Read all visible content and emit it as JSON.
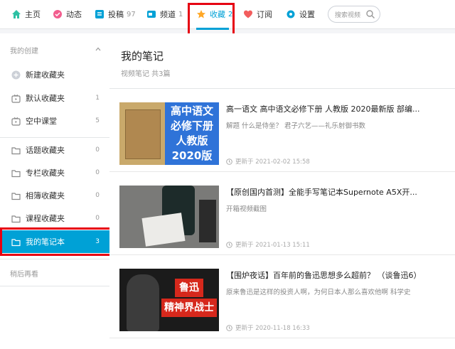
{
  "nav": {
    "home": "主页",
    "dynamic": "动态",
    "posts": "投稿",
    "posts_count": "97",
    "channel": "频道",
    "channel_count": "1",
    "favorites": "收藏",
    "favorites_count": "2",
    "subscribe": "订阅",
    "settings": "设置",
    "search_placeholder": "搜索视频"
  },
  "sidebar": {
    "my_created": "我的创建",
    "items": [
      {
        "label": "新建收藏夹",
        "count": ""
      },
      {
        "label": "默认收藏夹",
        "count": "1"
      },
      {
        "label": "空中课堂",
        "count": "5"
      },
      {
        "label": "话题收藏夹",
        "count": "0"
      },
      {
        "label": "专栏收藏夹",
        "count": "0"
      },
      {
        "label": "相簿收藏夹",
        "count": "0"
      },
      {
        "label": "课程收藏夹",
        "count": "0"
      },
      {
        "label": "我的笔记本",
        "count": "3"
      }
    ],
    "watch_later": "稍后再看"
  },
  "main": {
    "title": "我的笔记",
    "subtitle": "视频笔记 共3篇",
    "notes": [
      {
        "title": "高一语文 高中语文必修下册 人教版 2020最新版 部编...",
        "desc": "解题 什么是侍坐？ 君子六艺——礼乐射御书数",
        "time": "更新于 2021-02-02 15:58",
        "thumb_text": [
          "高中语文",
          "必修下册",
          "人教版",
          "2020版"
        ]
      },
      {
        "title": "【原创国内首测】全能手写笔记本Supernote A5X开...",
        "desc": "开箱视频截图",
        "time": "更新于 2021-01-13 15:11",
        "thumb_text": []
      },
      {
        "title": "【围炉夜话】百年前的鲁迅思想多么超前？ （谈鲁迅6）",
        "desc": "原来鲁迅是这样的投资人啊，为何日本人那么喜欢他啊 科学史",
        "time": "更新于 2020-11-18 16:33",
        "thumb_text": [
          "鲁迅",
          "精神界战士"
        ]
      }
    ]
  },
  "colors": {
    "accent": "#00a1d6",
    "highlight_red": "#e60012"
  }
}
